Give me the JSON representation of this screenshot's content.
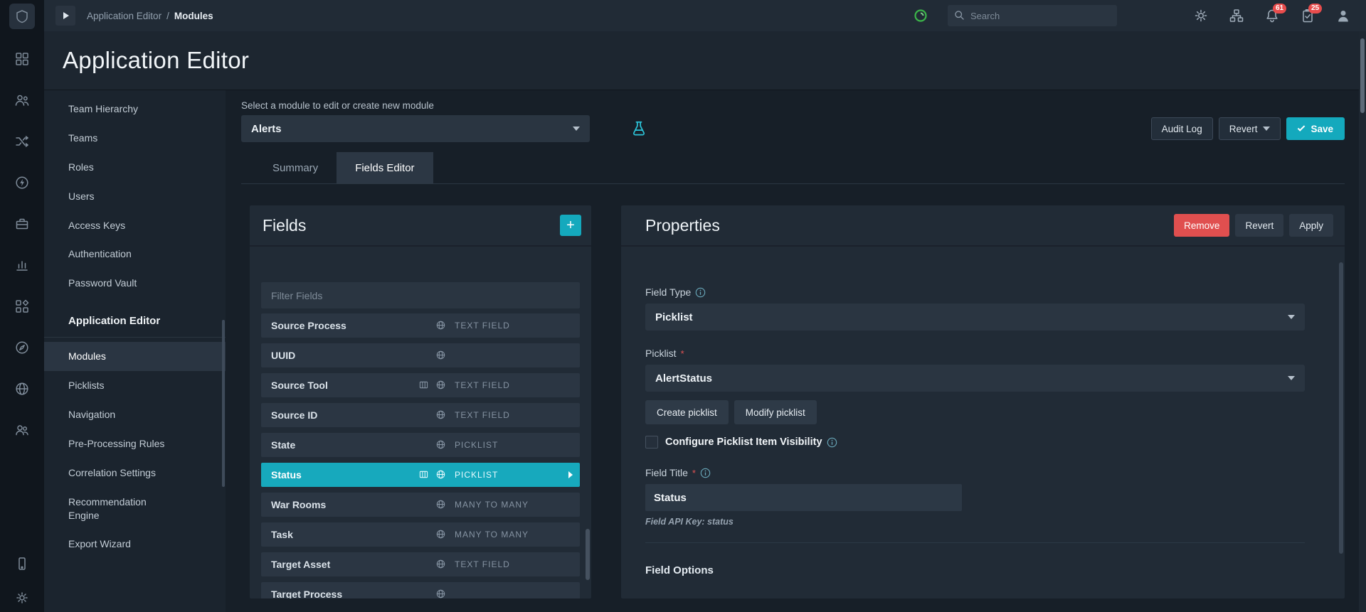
{
  "topbar": {
    "breadcrumb": {
      "parent": "Application Editor",
      "sep": "/",
      "current": "Modules"
    },
    "search": {
      "placeholder": "Search"
    },
    "badges": {
      "notifications": "61",
      "tasks": "25"
    },
    "icons": [
      "play-icon",
      "health-icon",
      "search-icon",
      "gear-icon",
      "sitemap-icon",
      "bell-icon",
      "clipboard-check-icon",
      "user-icon"
    ]
  },
  "page": {
    "title": "Application Editor"
  },
  "rail_icons": [
    "app-logo",
    "dashboard-icon",
    "queues-icon",
    "connectors-icon",
    "automation-icon",
    "case-icon",
    "reports-icon",
    "widgets-icon",
    "help-icon",
    "globe-icon",
    "users-icon",
    "device-icon",
    "settings-gear-icon"
  ],
  "sidebar": {
    "items": [
      "Team Hierarchy",
      "Teams",
      "Roles",
      "Users",
      "Access Keys",
      "Authentication",
      "Password Vault"
    ],
    "section": {
      "title": "Application Editor",
      "items": [
        {
          "label": "Modules",
          "active": true
        },
        {
          "label": "Picklists",
          "active": false
        },
        {
          "label": "Navigation",
          "active": false
        },
        {
          "label": "Pre-Processing Rules",
          "active": false
        },
        {
          "label": "Correlation Settings",
          "active": false
        },
        {
          "label": "Recommendation Engine",
          "active": false
        },
        {
          "label": "Export Wizard",
          "active": false
        }
      ]
    }
  },
  "module_bar": {
    "label": "Select a module to edit or create new module",
    "selected_module": "Alerts",
    "audit_log": "Audit Log",
    "revert": "Revert",
    "save": "Save"
  },
  "tabs": [
    {
      "label": "Summary",
      "active": false
    },
    {
      "label": "Fields Editor",
      "active": true
    }
  ],
  "fields_panel": {
    "title": "Fields",
    "add_button": "+",
    "filter_placeholder": "Filter Fields",
    "items": [
      {
        "name": "Source Process",
        "type": "TEXT FIELD",
        "grid_column": false,
        "global": true,
        "selected": false
      },
      {
        "name": "UUID",
        "type": "",
        "grid_column": false,
        "global": true,
        "selected": false
      },
      {
        "name": "Source Tool",
        "type": "TEXT FIELD",
        "grid_column": true,
        "global": true,
        "selected": false
      },
      {
        "name": "Source ID",
        "type": "TEXT FIELD",
        "grid_column": false,
        "global": true,
        "selected": false
      },
      {
        "name": "State",
        "type": "PICKLIST",
        "grid_column": false,
        "global": true,
        "selected": false
      },
      {
        "name": "Status",
        "type": "PICKLIST",
        "grid_column": true,
        "global": true,
        "selected": true
      },
      {
        "name": "War Rooms",
        "type": "MANY TO MANY",
        "grid_column": false,
        "global": true,
        "selected": false
      },
      {
        "name": "Task",
        "type": "MANY TO MANY",
        "grid_column": false,
        "global": true,
        "selected": false
      },
      {
        "name": "Target Asset",
        "type": "TEXT FIELD",
        "grid_column": false,
        "global": true,
        "selected": false
      },
      {
        "name": "Target Process",
        "type": "",
        "grid_column": false,
        "global": true,
        "selected": false
      }
    ]
  },
  "properties_panel": {
    "title": "Properties",
    "remove": "Remove",
    "revert": "Revert",
    "apply": "Apply",
    "field_type": {
      "label": "Field Type",
      "value": "Picklist"
    },
    "picklist": {
      "label": "Picklist",
      "required": "*",
      "value": "AlertStatus"
    },
    "create_picklist": "Create picklist",
    "modify_picklist": "Modify picklist",
    "visibility_checkbox": {
      "label": "Configure Picklist Item Visibility",
      "checked": false
    },
    "field_title": {
      "label": "Field Title",
      "required": "*",
      "value": "Status"
    },
    "api_key": "Field API Key: status",
    "section": "Field Options"
  },
  "colors": {
    "accent": "#14a9bd",
    "danger": "#e04f4f",
    "badge": "#e84c4c",
    "health_green": "#3cb54a"
  }
}
